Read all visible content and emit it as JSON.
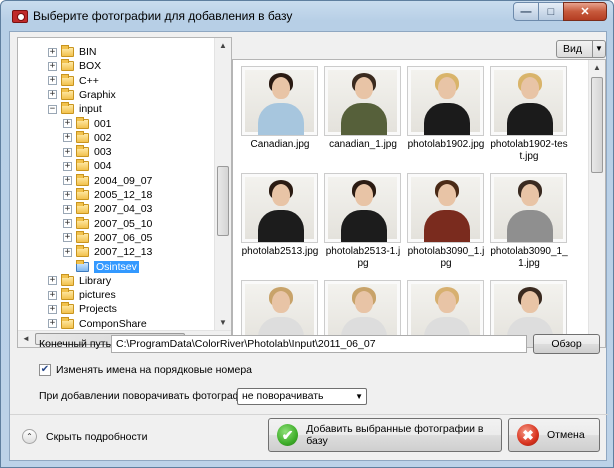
{
  "window": {
    "title": "Выберите фотографии для добавления в базу",
    "controls": {
      "minimize": "—",
      "maximize": "□",
      "close": "✕"
    }
  },
  "tree": {
    "items": [
      {
        "label": "BIN",
        "level": 0,
        "expander": "+"
      },
      {
        "label": "BOX",
        "level": 0,
        "expander": "+"
      },
      {
        "label": "C++",
        "level": 0,
        "expander": "+"
      },
      {
        "label": "Graphix",
        "level": 0,
        "expander": "+"
      },
      {
        "label": "input",
        "level": 0,
        "expander": "−"
      },
      {
        "label": "001",
        "level": 1,
        "expander": "+"
      },
      {
        "label": "002",
        "level": 1,
        "expander": "+"
      },
      {
        "label": "003",
        "level": 1,
        "expander": "+"
      },
      {
        "label": "004",
        "level": 1,
        "expander": "+"
      },
      {
        "label": "2004_09_07",
        "level": 1,
        "expander": "+"
      },
      {
        "label": "2005_12_18",
        "level": 1,
        "expander": "+"
      },
      {
        "label": "2007_04_03",
        "level": 1,
        "expander": "+"
      },
      {
        "label": "2007_05_10",
        "level": 1,
        "expander": "+"
      },
      {
        "label": "2007_06_05",
        "level": 1,
        "expander": "+"
      },
      {
        "label": "2007_12_13",
        "level": 1,
        "expander": "+"
      },
      {
        "label": "Osintsev",
        "level": 1,
        "expander": "",
        "selected": true
      },
      {
        "label": "Library",
        "level": 0,
        "expander": "+"
      },
      {
        "label": "pictures",
        "level": 0,
        "expander": "+"
      },
      {
        "label": "Projects",
        "level": 0,
        "expander": "+"
      },
      {
        "label": "ComponShare",
        "level": 0,
        "expander": "+"
      }
    ]
  },
  "view_button": {
    "label": "Вид",
    "arrow": "▼"
  },
  "gallery": {
    "photos": [
      {
        "caption": "Canadian.jpg",
        "hair": "#2a1a12",
        "top": "#a7c6de"
      },
      {
        "caption": "canadian_1.jpg",
        "hair": "#3a2a1e",
        "top": "#56603a"
      },
      {
        "caption": "photolab1902.jpg",
        "hair": "#d9b46a",
        "top": "#1b1b1b"
      },
      {
        "caption": "photolab1902-test.jpg",
        "hair": "#d9b46a",
        "top": "#1b1b1b"
      },
      {
        "caption": "photolab2513.jpg",
        "hair": "#2b1b12",
        "top": "#1c1c1c"
      },
      {
        "caption": "photolab2513-1.jpg",
        "hair": "#2b1b12",
        "top": "#1c1c1c"
      },
      {
        "caption": "photolab3090_1.jpg",
        "hair": "#4a2a16",
        "top": "#7a2b1e"
      },
      {
        "caption": "photolab3090_1_1.jpg",
        "hair": "#3a2a20",
        "top": "#8f8f8f"
      },
      {
        "caption": "",
        "hair": "#c8a36a",
        "top": "#ddd"
      },
      {
        "caption": "",
        "hair": "#c8a36a",
        "top": "#ddd"
      },
      {
        "caption": "",
        "hair": "#d7b070",
        "top": "#ddd"
      },
      {
        "caption": "",
        "hair": "#3a2a20",
        "top": "#ddd"
      }
    ]
  },
  "form": {
    "dest_label": "Конечный путь",
    "dest_value": "C:\\ProgramData\\ColorRiver\\Photolab\\Input\\2011_06_07",
    "browse_label": "Обзор",
    "rename_label": "Изменять имена на порядковые номера",
    "rename_checked": "✔",
    "rotate_label": "При добавлении поворачивать фотографии:",
    "rotate_value": "не поворачивать",
    "rotate_arrow": "▼"
  },
  "footer": {
    "details_icon": "⌃",
    "details_label": "Скрыть подробности",
    "add_label": "Добавить выбранные фотографии в базу",
    "add_icon": "✔",
    "cancel_label": "Отмена",
    "cancel_icon": "✖"
  },
  "scroll": {
    "up": "▲",
    "down": "▼",
    "left": "◄",
    "right": "►"
  },
  "colors": {
    "selection": "#3399ff",
    "ok_green": "#3fae2a",
    "cancel_red": "#d8321e"
  }
}
